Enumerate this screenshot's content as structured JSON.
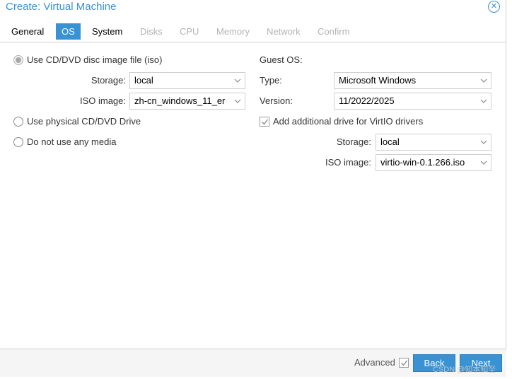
{
  "window": {
    "title": "Create: Virtual Machine"
  },
  "tabs": [
    {
      "label": "General",
      "state": "normal"
    },
    {
      "label": "OS",
      "state": "active"
    },
    {
      "label": "System",
      "state": "normal"
    },
    {
      "label": "Disks",
      "state": "disabled"
    },
    {
      "label": "CPU",
      "state": "disabled"
    },
    {
      "label": "Memory",
      "state": "disabled"
    },
    {
      "label": "Network",
      "state": "disabled"
    },
    {
      "label": "Confirm",
      "state": "disabled"
    }
  ],
  "media": {
    "iso_option": {
      "label": "Use CD/DVD disc image file (iso)",
      "checked": true
    },
    "storage": {
      "label": "Storage:",
      "value": "local"
    },
    "iso_image": {
      "label": "ISO image:",
      "value": "zh-cn_windows_11_er"
    },
    "physical_option": {
      "label": "Use physical CD/DVD Drive",
      "checked": false
    },
    "none_option": {
      "label": "Do not use any media",
      "checked": false
    }
  },
  "guest": {
    "heading": "Guest OS:",
    "type": {
      "label": "Type:",
      "value": "Microsoft Windows"
    },
    "version": {
      "label": "Version:",
      "value": "11/2022/2025"
    },
    "virtio_checkbox": {
      "label": "Add additional drive for VirtIO drivers",
      "checked": true
    },
    "storage": {
      "label": "Storage:",
      "value": "local"
    },
    "iso_image": {
      "label": "ISO image:",
      "value": "virtio-win-0.1.266.iso"
    }
  },
  "footer": {
    "advanced_label": "Advanced",
    "advanced_checked": true,
    "back_label": "Back",
    "next_label": "Next",
    "watermark": "CSDN @知本知至"
  },
  "colors": {
    "accent": "#3892d4",
    "disabled_text": "#b3b3b3",
    "footer_bg": "#f5f5f5"
  }
}
